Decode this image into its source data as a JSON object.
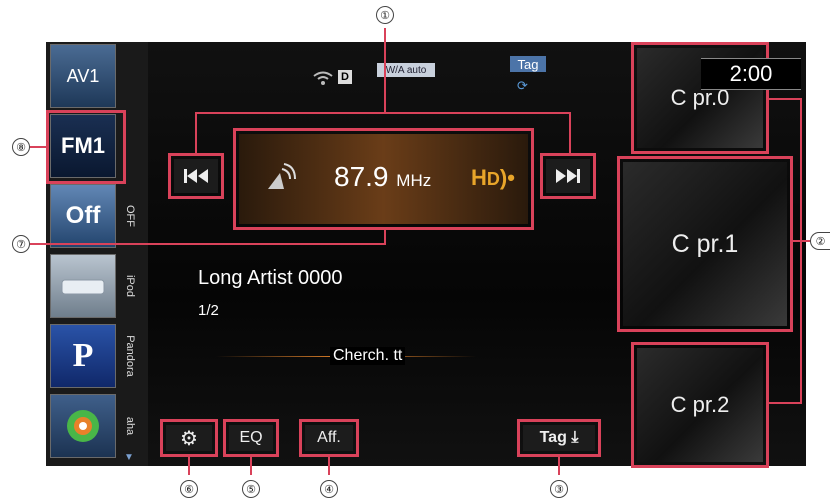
{
  "sources": [
    {
      "label": "AV1"
    },
    {
      "label": "FM1"
    },
    {
      "label": "Off"
    },
    {
      "label": ""
    },
    {
      "label": "P"
    },
    {
      "label": ""
    }
  ],
  "source_side_labels": [
    "OFF",
    "iPod",
    "Pandora",
    "aha"
  ],
  "status": {
    "hd_auto": "W/A auto",
    "tag": "Tag",
    "clock": "2:00"
  },
  "tuner": {
    "frequency": "87.9",
    "unit": "MHz"
  },
  "track": {
    "artist": "Long Artist 0000",
    "counter": "1/2",
    "status_text": "Cherch. tt"
  },
  "presets": [
    {
      "label": "C pr.0"
    },
    {
      "label": "C pr.1"
    },
    {
      "label": "C pr.2"
    }
  ],
  "buttons": {
    "eq": "EQ",
    "aff": "Aff.",
    "tag": "Tag"
  },
  "callouts": [
    "①",
    "②",
    "③",
    "④",
    "⑤",
    "⑥",
    "⑦",
    "⑧"
  ],
  "colors": {
    "highlight": "#d9425a",
    "tuner_bg": "#5a3517",
    "accent": "#e8a52a"
  }
}
